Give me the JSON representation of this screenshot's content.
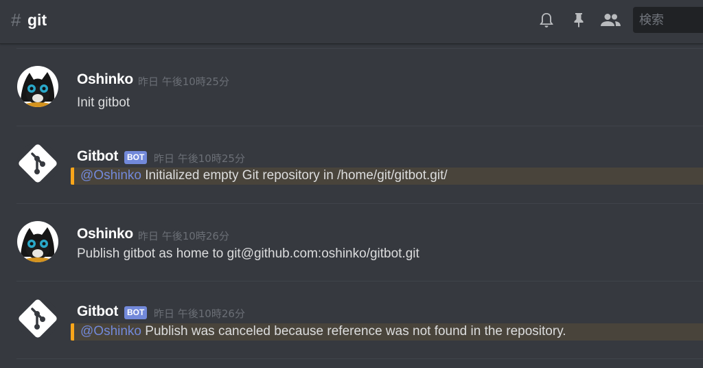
{
  "channel": {
    "hash": "#",
    "name": "git"
  },
  "header": {
    "icons": [
      "bell-icon",
      "pin-icon",
      "members-icon"
    ],
    "search_placeholder": "検索"
  },
  "messages": [
    {
      "author": "Oshinko",
      "is_bot": false,
      "timestamp": "昨日 午後10時25分",
      "text": "Init gitbot",
      "mention": "",
      "avatar": "cat-avatar"
    },
    {
      "author": "Gitbot",
      "is_bot": true,
      "bot_tag": "BOT",
      "timestamp": "昨日 午後10時25分",
      "mention": "@Oshinko",
      "text": "Initialized empty Git repository in /home/git/gitbot.git/",
      "avatar": "git-logo-avatar"
    },
    {
      "author": "Oshinko",
      "is_bot": false,
      "timestamp": "昨日 午後10時26分",
      "text": "Publish gitbot as home to git@github.com:oshinko/gitbot.git",
      "mention": "",
      "avatar": "cat-avatar"
    },
    {
      "author": "Gitbot",
      "is_bot": true,
      "bot_tag": "BOT",
      "timestamp": "昨日 午後10時26分",
      "mention": "@Oshinko",
      "text": "Publish was canceled because reference was not found in the repository.",
      "avatar": "git-logo-avatar"
    }
  ],
  "colors": {
    "background": "#36393f",
    "mention": "#7289da",
    "highlight_bar": "#faa61a",
    "bot_tag": "#7289da"
  }
}
